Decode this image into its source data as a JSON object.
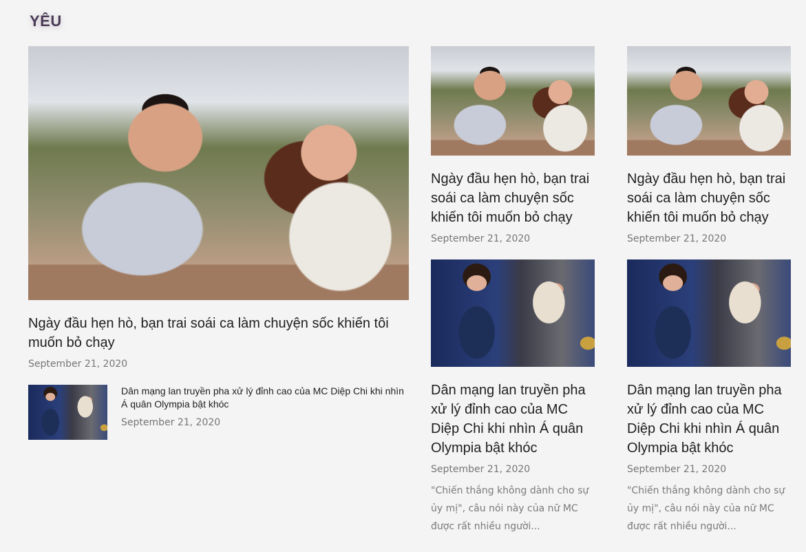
{
  "section": {
    "title": "YÊU"
  },
  "featured": {
    "image_subject": "couple-on-date-photo",
    "title": "Ngày đầu hẹn hò, bạn trai soái ca làm chuyện sốc khiến tôi muốn bỏ chạy",
    "date": "September 21, 2020"
  },
  "small_item": {
    "image_subject": "mc-olympia-photo",
    "title": "Dân mạng lan truyền pha xử lý đỉnh cao của MC Diệp Chi khi nhìn Á quân Olympia bật khóc",
    "date": "September 21, 2020"
  },
  "grid": [
    {
      "image_subject": "couple-on-date-photo",
      "title": "Ngày đầu hẹn hò, bạn trai soái ca làm chuyện sốc khiến tôi muốn bỏ chạy",
      "date": "September 21, 2020"
    },
    {
      "image_subject": "couple-on-date-photo",
      "title": "Ngày đầu hẹn hò, bạn trai soái ca làm chuyện sốc khiến tôi muốn bỏ chạy",
      "date": "September 21, 2020"
    },
    {
      "image_subject": "mc-olympia-photo",
      "title": "Dân mạng lan truyền pha xử lý đỉnh cao của MC Diệp Chi khi nhìn Á quân Olympia bật khóc",
      "date": "September 21, 2020",
      "excerpt": "\"Chiến thắng không dành cho sự ủy mị\", câu nói này của nữ MC được rất nhiều người..."
    },
    {
      "image_subject": "mc-olympia-photo",
      "title": "Dân mạng lan truyền pha xử lý đỉnh cao của MC Diệp Chi khi nhìn Á quân Olympia bật khóc",
      "date": "September 21, 2020",
      "excerpt": "\"Chiến thắng không dành cho sự ủy mị\", câu nói này của nữ MC được rất nhiều người..."
    }
  ],
  "colors": {
    "background": "#f4f4f4",
    "section_title": "#4a3a55",
    "meta_text": "#767676"
  }
}
